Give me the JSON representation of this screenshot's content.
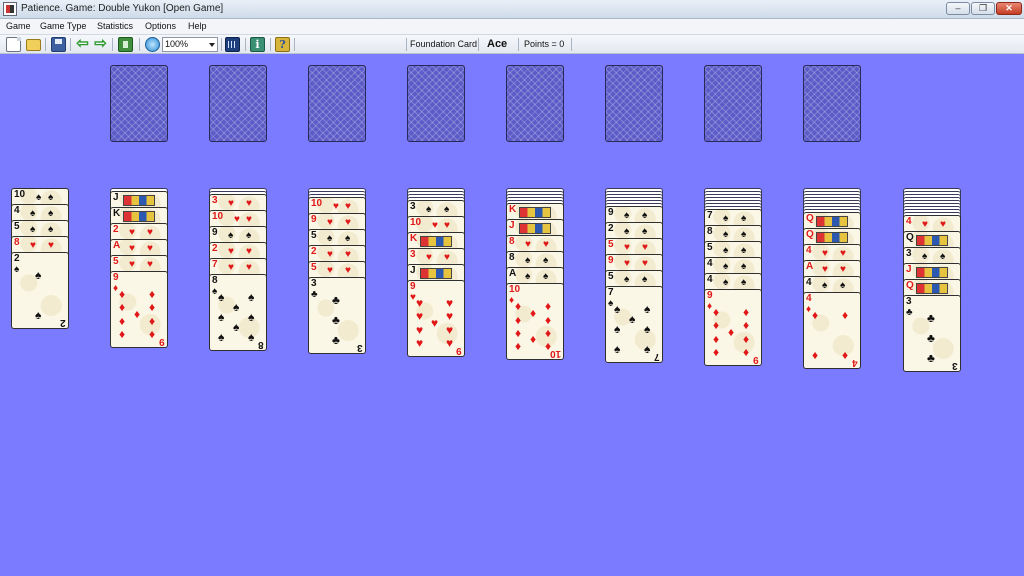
{
  "window": {
    "title": "Patience. Game: Double Yukon  [Open Game]",
    "minimize_icon": "minimize-icon",
    "maximize_icon": "maximize-icon",
    "close_icon": "close-icon"
  },
  "menu": [
    "Game",
    "Game Type",
    "Statistics",
    "Options",
    "Help"
  ],
  "toolbar": {
    "zoom": "100%",
    "foundation_label": "Foundation Card",
    "foundation_value": "Ace",
    "points": "Points = 0"
  },
  "colors": {
    "table": "#7b7bff",
    "red_suit": "#e01818",
    "black_suit": "#111111"
  },
  "foundations": 8,
  "tableau": [
    {
      "hidden": 0,
      "cards": [
        [
          "10",
          "spades"
        ],
        [
          "4",
          "spades"
        ],
        [
          "5",
          "spades"
        ],
        [
          "8",
          "hearts"
        ],
        [
          "2",
          "spades"
        ]
      ]
    },
    {
      "hidden": 1,
      "cards": [
        [
          "J",
          "clubs"
        ],
        [
          "K",
          "spades"
        ],
        [
          "2",
          "hearts"
        ],
        [
          "A",
          "hearts"
        ],
        [
          "5",
          "hearts"
        ],
        [
          "9",
          "diamonds"
        ]
      ]
    },
    {
      "hidden": 2,
      "cards": [
        [
          "3",
          "hearts"
        ],
        [
          "10",
          "hearts"
        ],
        [
          "9",
          "spades"
        ],
        [
          "2",
          "hearts"
        ],
        [
          "7",
          "hearts"
        ],
        [
          "8",
          "spades"
        ]
      ]
    },
    {
      "hidden": 3,
      "cards": [
        [
          "10",
          "hearts"
        ],
        [
          "9",
          "hearts"
        ],
        [
          "5",
          "spades"
        ],
        [
          "2",
          "hearts"
        ],
        [
          "5",
          "hearts"
        ],
        [
          "3",
          "clubs"
        ]
      ]
    },
    {
      "hidden": 4,
      "cards": [
        [
          "3",
          "spades"
        ],
        [
          "10",
          "hearts"
        ],
        [
          "K",
          "hearts"
        ],
        [
          "3",
          "hearts"
        ],
        [
          "J",
          "spades"
        ],
        [
          "9",
          "hearts"
        ]
      ]
    },
    {
      "hidden": 5,
      "cards": [
        [
          "K",
          "hearts"
        ],
        [
          "J",
          "hearts"
        ],
        [
          "8",
          "hearts"
        ],
        [
          "8",
          "spades"
        ],
        [
          "A",
          "spades"
        ],
        [
          "10",
          "diamonds"
        ]
      ]
    },
    {
      "hidden": 6,
      "cards": [
        [
          "9",
          "spades"
        ],
        [
          "2",
          "spades"
        ],
        [
          "5",
          "hearts"
        ],
        [
          "9",
          "hearts"
        ],
        [
          "5",
          "spades"
        ],
        [
          "7",
          "spades"
        ]
      ]
    },
    {
      "hidden": 7,
      "cards": [
        [
          "7",
          "spades"
        ],
        [
          "8",
          "spades"
        ],
        [
          "5",
          "spades"
        ],
        [
          "4",
          "spades"
        ],
        [
          "4",
          "spades"
        ],
        [
          "9",
          "diamonds"
        ]
      ]
    },
    {
      "hidden": 8,
      "cards": [
        [
          "Q",
          "hearts"
        ],
        [
          "Q",
          "hearts"
        ],
        [
          "4",
          "hearts"
        ],
        [
          "A",
          "hearts"
        ],
        [
          "4",
          "spades"
        ],
        [
          "4",
          "diamonds"
        ]
      ]
    },
    {
      "hidden": 9,
      "cards": [
        [
          "4",
          "hearts"
        ],
        [
          "Q",
          "spades"
        ],
        [
          "3",
          "spades"
        ],
        [
          "J",
          "hearts"
        ],
        [
          "Q",
          "hearts"
        ],
        [
          "3",
          "clubs"
        ]
      ]
    }
  ]
}
